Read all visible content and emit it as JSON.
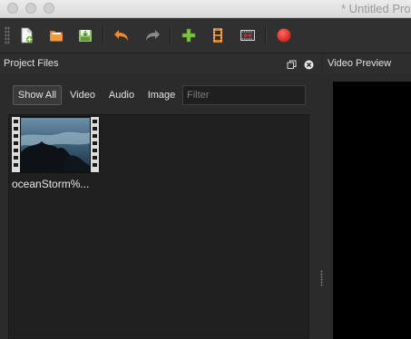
{
  "window": {
    "title": "* Untitled Pro"
  },
  "toolbar": {
    "buttons": [
      {
        "name": "new-project",
        "icon": "new-file-icon"
      },
      {
        "name": "open-project",
        "icon": "folder-open-icon"
      },
      {
        "name": "save-project",
        "icon": "save-icon"
      },
      {
        "name": "undo",
        "icon": "undo-icon"
      },
      {
        "name": "redo",
        "icon": "redo-icon"
      },
      {
        "name": "import-files",
        "icon": "plus-icon"
      },
      {
        "name": "profile",
        "icon": "film-icon"
      },
      {
        "name": "fullscreen",
        "icon": "fullscreen-icon"
      },
      {
        "name": "export",
        "icon": "record-icon"
      }
    ]
  },
  "project_files": {
    "title": "Project Files",
    "filters": [
      "Show All",
      "Video",
      "Audio",
      "Image"
    ],
    "active_filter": "Show All",
    "filter_placeholder": "Filter",
    "filter_value": "",
    "files": [
      {
        "name": "oceanStorm%..."
      }
    ]
  },
  "video_preview": {
    "title": "Video Preview"
  },
  "colors": {
    "accent_green": "#7cc63a",
    "record_red": "#e0302a",
    "undo_orange": "#f08a24",
    "panel_bg": "#2b2b2b",
    "files_bg": "#202020"
  }
}
